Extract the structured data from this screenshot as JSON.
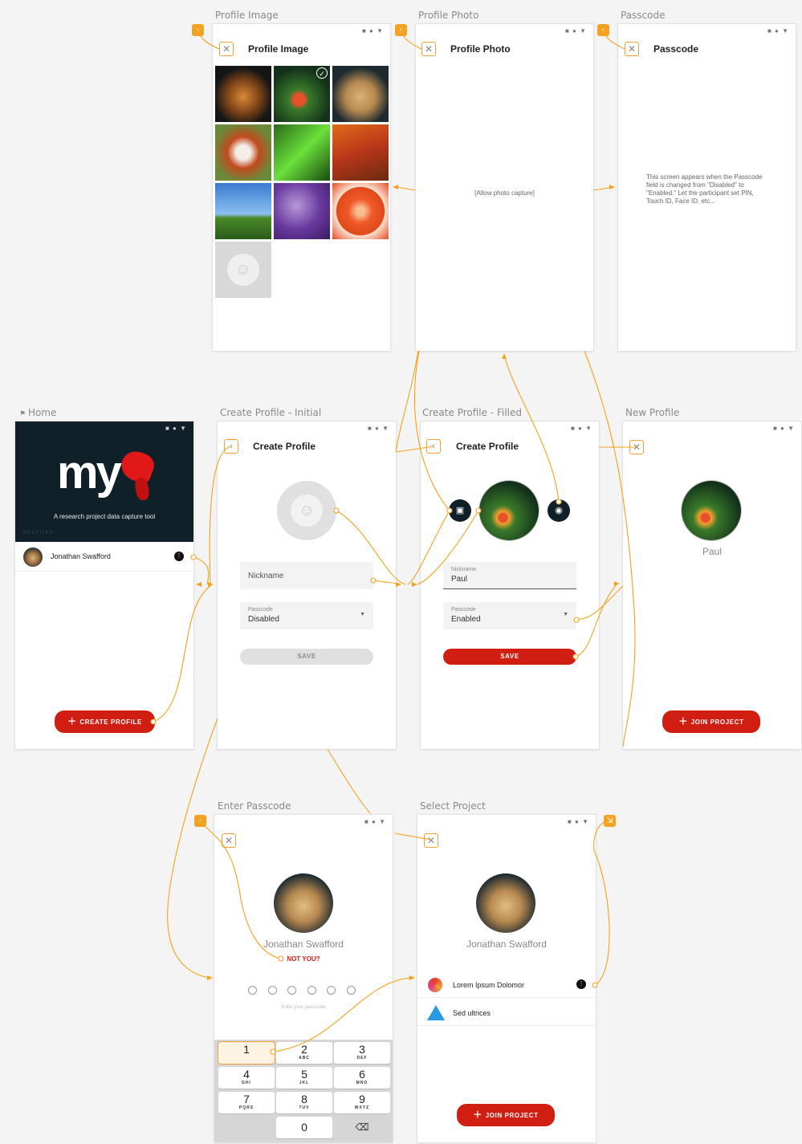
{
  "labels": {
    "profile_image": "Profile Image",
    "profile_photo": "Profile Photo",
    "passcode": "Passcode",
    "home": "Home",
    "create_initial": "Create Profile - Initial",
    "create_filled": "Create Profile - Filled",
    "new_profile": "New Profile",
    "enter_passcode": "Enter Passcode",
    "select_project": "Select Project"
  },
  "status_icons": "■ ● ▼",
  "profile_image": {
    "title": "Profile Image"
  },
  "profile_photo": {
    "title": "Profile Photo",
    "placeholder": "[Allow photo capture]"
  },
  "passcode": {
    "title": "Passcode",
    "note": "This screen appears when the Passcode field is changed from \"Disabled\" to \"Enabled.\" Let the participant set PIN, Touch ID, Face ID, etc..."
  },
  "home": {
    "logo": "my",
    "tagline": "A research project data capture tool",
    "section": "PROFILES",
    "profile_name": "Jonathan Swafford",
    "create_button": "CREATE PROFILE"
  },
  "create_initial": {
    "title": "Create Profile",
    "nickname_placeholder": "Nickname",
    "passcode_label": "Passcode",
    "passcode_value": "Disabled",
    "save": "SAVE"
  },
  "create_filled": {
    "title": "Create Profile",
    "nickname_label": "Nickname",
    "nickname_value": "Paul",
    "passcode_label": "Passcode",
    "passcode_value": "Enabled",
    "save": "SAVE"
  },
  "new_profile": {
    "name": "Paul",
    "join_button": "JOIN PROJECT"
  },
  "enter_passcode": {
    "name": "Jonathan Swafford",
    "not_you": "NOT YOU?",
    "hint": "Enter your passcode",
    "keys": [
      {
        "n": "1",
        "s": ""
      },
      {
        "n": "2",
        "s": "ABC"
      },
      {
        "n": "3",
        "s": "DEF"
      },
      {
        "n": "4",
        "s": "GHI"
      },
      {
        "n": "5",
        "s": "JKL"
      },
      {
        "n": "6",
        "s": "MNO"
      },
      {
        "n": "7",
        "s": "PQRS"
      },
      {
        "n": "8",
        "s": "TUV"
      },
      {
        "n": "9",
        "s": "WXYZ"
      },
      {
        "n": "0",
        "s": ""
      }
    ]
  },
  "select_project": {
    "name": "Jonathan Swafford",
    "projects": [
      "Lorem Ipsum Dolomor",
      "Sed ultrices"
    ],
    "join_button": "JOIN PROJECT"
  },
  "colors": {
    "accent": "#f4a21f",
    "red": "#d01e12",
    "dark": "#102028"
  }
}
